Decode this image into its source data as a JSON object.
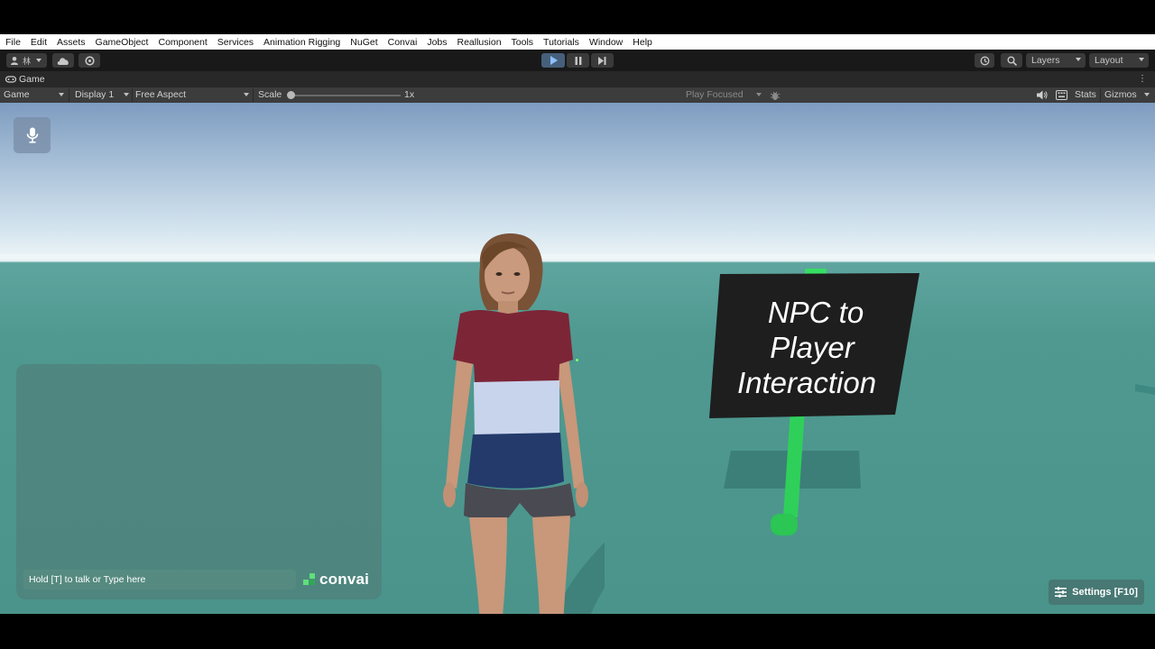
{
  "menu": [
    "File",
    "Edit",
    "Assets",
    "GameObject",
    "Component",
    "Services",
    "Animation Rigging",
    "NuGet",
    "Convai",
    "Jobs",
    "Reallusion",
    "Tools",
    "Tutorials",
    "Window",
    "Help"
  ],
  "toolbar": {
    "account_glyph": "林",
    "layers_label": "Layers",
    "layout_label": "Layout"
  },
  "tab": {
    "title": "Game"
  },
  "gamebar": {
    "mode": "Game",
    "display": "Display 1",
    "aspect": "Free Aspect",
    "scale_label": "Scale",
    "scale_value": "1x",
    "scale_fraction": 0.0,
    "play_mode": "Play Focused",
    "stats_label": "Stats",
    "gizmos_label": "Gizmos"
  },
  "overlay": {
    "chat_placeholder": "Hold [T] to talk or Type here",
    "brand": "convai",
    "settings_label": "Settings [F10]"
  },
  "scene": {
    "sign_lines": [
      "NPC to",
      "Player",
      "Interaction"
    ]
  },
  "colors": {
    "play_active": "#46607c",
    "sign_green": "#2fd05a",
    "sign_board": "#1e1e1e",
    "ground": "#4f9990"
  }
}
